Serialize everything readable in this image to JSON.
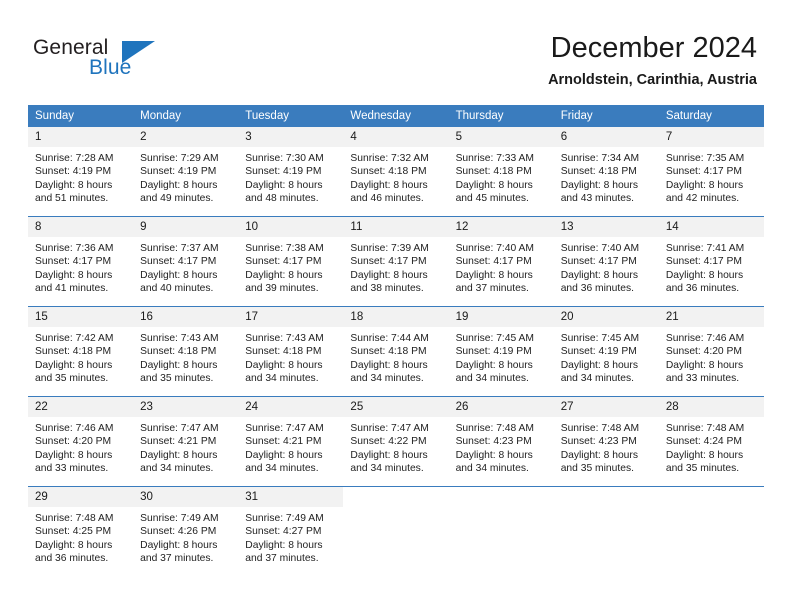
{
  "brand": {
    "name_top": "General",
    "name_bottom": "Blue",
    "flag_icon": "triangle-flag-icon",
    "accent_color": "#1f74bd"
  },
  "header": {
    "title": "December 2024",
    "subtitle": "Arnoldstein, Carinthia, Austria"
  },
  "calendar": {
    "header_color": "#3a7cbe",
    "daynum_band_color": "#f2f2f2",
    "weekday_headers": [
      "Sunday",
      "Monday",
      "Tuesday",
      "Wednesday",
      "Thursday",
      "Friday",
      "Saturday"
    ],
    "weeks": [
      [
        {
          "day": "1",
          "sunrise": "Sunrise: 7:28 AM",
          "sunset": "Sunset: 4:19 PM",
          "daylight_1": "Daylight: 8 hours",
          "daylight_2": "and 51 minutes."
        },
        {
          "day": "2",
          "sunrise": "Sunrise: 7:29 AM",
          "sunset": "Sunset: 4:19 PM",
          "daylight_1": "Daylight: 8 hours",
          "daylight_2": "and 49 minutes."
        },
        {
          "day": "3",
          "sunrise": "Sunrise: 7:30 AM",
          "sunset": "Sunset: 4:19 PM",
          "daylight_1": "Daylight: 8 hours",
          "daylight_2": "and 48 minutes."
        },
        {
          "day": "4",
          "sunrise": "Sunrise: 7:32 AM",
          "sunset": "Sunset: 4:18 PM",
          "daylight_1": "Daylight: 8 hours",
          "daylight_2": "and 46 minutes."
        },
        {
          "day": "5",
          "sunrise": "Sunrise: 7:33 AM",
          "sunset": "Sunset: 4:18 PM",
          "daylight_1": "Daylight: 8 hours",
          "daylight_2": "and 45 minutes."
        },
        {
          "day": "6",
          "sunrise": "Sunrise: 7:34 AM",
          "sunset": "Sunset: 4:18 PM",
          "daylight_1": "Daylight: 8 hours",
          "daylight_2": "and 43 minutes."
        },
        {
          "day": "7",
          "sunrise": "Sunrise: 7:35 AM",
          "sunset": "Sunset: 4:17 PM",
          "daylight_1": "Daylight: 8 hours",
          "daylight_2": "and 42 minutes."
        }
      ],
      [
        {
          "day": "8",
          "sunrise": "Sunrise: 7:36 AM",
          "sunset": "Sunset: 4:17 PM",
          "daylight_1": "Daylight: 8 hours",
          "daylight_2": "and 41 minutes."
        },
        {
          "day": "9",
          "sunrise": "Sunrise: 7:37 AM",
          "sunset": "Sunset: 4:17 PM",
          "daylight_1": "Daylight: 8 hours",
          "daylight_2": "and 40 minutes."
        },
        {
          "day": "10",
          "sunrise": "Sunrise: 7:38 AM",
          "sunset": "Sunset: 4:17 PM",
          "daylight_1": "Daylight: 8 hours",
          "daylight_2": "and 39 minutes."
        },
        {
          "day": "11",
          "sunrise": "Sunrise: 7:39 AM",
          "sunset": "Sunset: 4:17 PM",
          "daylight_1": "Daylight: 8 hours",
          "daylight_2": "and 38 minutes."
        },
        {
          "day": "12",
          "sunrise": "Sunrise: 7:40 AM",
          "sunset": "Sunset: 4:17 PM",
          "daylight_1": "Daylight: 8 hours",
          "daylight_2": "and 37 minutes."
        },
        {
          "day": "13",
          "sunrise": "Sunrise: 7:40 AM",
          "sunset": "Sunset: 4:17 PM",
          "daylight_1": "Daylight: 8 hours",
          "daylight_2": "and 36 minutes."
        },
        {
          "day": "14",
          "sunrise": "Sunrise: 7:41 AM",
          "sunset": "Sunset: 4:17 PM",
          "daylight_1": "Daylight: 8 hours",
          "daylight_2": "and 36 minutes."
        }
      ],
      [
        {
          "day": "15",
          "sunrise": "Sunrise: 7:42 AM",
          "sunset": "Sunset: 4:18 PM",
          "daylight_1": "Daylight: 8 hours",
          "daylight_2": "and 35 minutes."
        },
        {
          "day": "16",
          "sunrise": "Sunrise: 7:43 AM",
          "sunset": "Sunset: 4:18 PM",
          "daylight_1": "Daylight: 8 hours",
          "daylight_2": "and 35 minutes."
        },
        {
          "day": "17",
          "sunrise": "Sunrise: 7:43 AM",
          "sunset": "Sunset: 4:18 PM",
          "daylight_1": "Daylight: 8 hours",
          "daylight_2": "and 34 minutes."
        },
        {
          "day": "18",
          "sunrise": "Sunrise: 7:44 AM",
          "sunset": "Sunset: 4:18 PM",
          "daylight_1": "Daylight: 8 hours",
          "daylight_2": "and 34 minutes."
        },
        {
          "day": "19",
          "sunrise": "Sunrise: 7:45 AM",
          "sunset": "Sunset: 4:19 PM",
          "daylight_1": "Daylight: 8 hours",
          "daylight_2": "and 34 minutes."
        },
        {
          "day": "20",
          "sunrise": "Sunrise: 7:45 AM",
          "sunset": "Sunset: 4:19 PM",
          "daylight_1": "Daylight: 8 hours",
          "daylight_2": "and 34 minutes."
        },
        {
          "day": "21",
          "sunrise": "Sunrise: 7:46 AM",
          "sunset": "Sunset: 4:20 PM",
          "daylight_1": "Daylight: 8 hours",
          "daylight_2": "and 33 minutes."
        }
      ],
      [
        {
          "day": "22",
          "sunrise": "Sunrise: 7:46 AM",
          "sunset": "Sunset: 4:20 PM",
          "daylight_1": "Daylight: 8 hours",
          "daylight_2": "and 33 minutes."
        },
        {
          "day": "23",
          "sunrise": "Sunrise: 7:47 AM",
          "sunset": "Sunset: 4:21 PM",
          "daylight_1": "Daylight: 8 hours",
          "daylight_2": "and 34 minutes."
        },
        {
          "day": "24",
          "sunrise": "Sunrise: 7:47 AM",
          "sunset": "Sunset: 4:21 PM",
          "daylight_1": "Daylight: 8 hours",
          "daylight_2": "and 34 minutes."
        },
        {
          "day": "25",
          "sunrise": "Sunrise: 7:47 AM",
          "sunset": "Sunset: 4:22 PM",
          "daylight_1": "Daylight: 8 hours",
          "daylight_2": "and 34 minutes."
        },
        {
          "day": "26",
          "sunrise": "Sunrise: 7:48 AM",
          "sunset": "Sunset: 4:23 PM",
          "daylight_1": "Daylight: 8 hours",
          "daylight_2": "and 34 minutes."
        },
        {
          "day": "27",
          "sunrise": "Sunrise: 7:48 AM",
          "sunset": "Sunset: 4:23 PM",
          "daylight_1": "Daylight: 8 hours",
          "daylight_2": "and 35 minutes."
        },
        {
          "day": "28",
          "sunrise": "Sunrise: 7:48 AM",
          "sunset": "Sunset: 4:24 PM",
          "daylight_1": "Daylight: 8 hours",
          "daylight_2": "and 35 minutes."
        }
      ],
      [
        {
          "day": "29",
          "sunrise": "Sunrise: 7:48 AM",
          "sunset": "Sunset: 4:25 PM",
          "daylight_1": "Daylight: 8 hours",
          "daylight_2": "and 36 minutes."
        },
        {
          "day": "30",
          "sunrise": "Sunrise: 7:49 AM",
          "sunset": "Sunset: 4:26 PM",
          "daylight_1": "Daylight: 8 hours",
          "daylight_2": "and 37 minutes."
        },
        {
          "day": "31",
          "sunrise": "Sunrise: 7:49 AM",
          "sunset": "Sunset: 4:27 PM",
          "daylight_1": "Daylight: 8 hours",
          "daylight_2": "and 37 minutes."
        },
        {
          "day": "",
          "sunrise": "",
          "sunset": "",
          "daylight_1": "",
          "daylight_2": ""
        },
        {
          "day": "",
          "sunrise": "",
          "sunset": "",
          "daylight_1": "",
          "daylight_2": ""
        },
        {
          "day": "",
          "sunrise": "",
          "sunset": "",
          "daylight_1": "",
          "daylight_2": ""
        },
        {
          "day": "",
          "sunrise": "",
          "sunset": "",
          "daylight_1": "",
          "daylight_2": ""
        }
      ]
    ]
  }
}
